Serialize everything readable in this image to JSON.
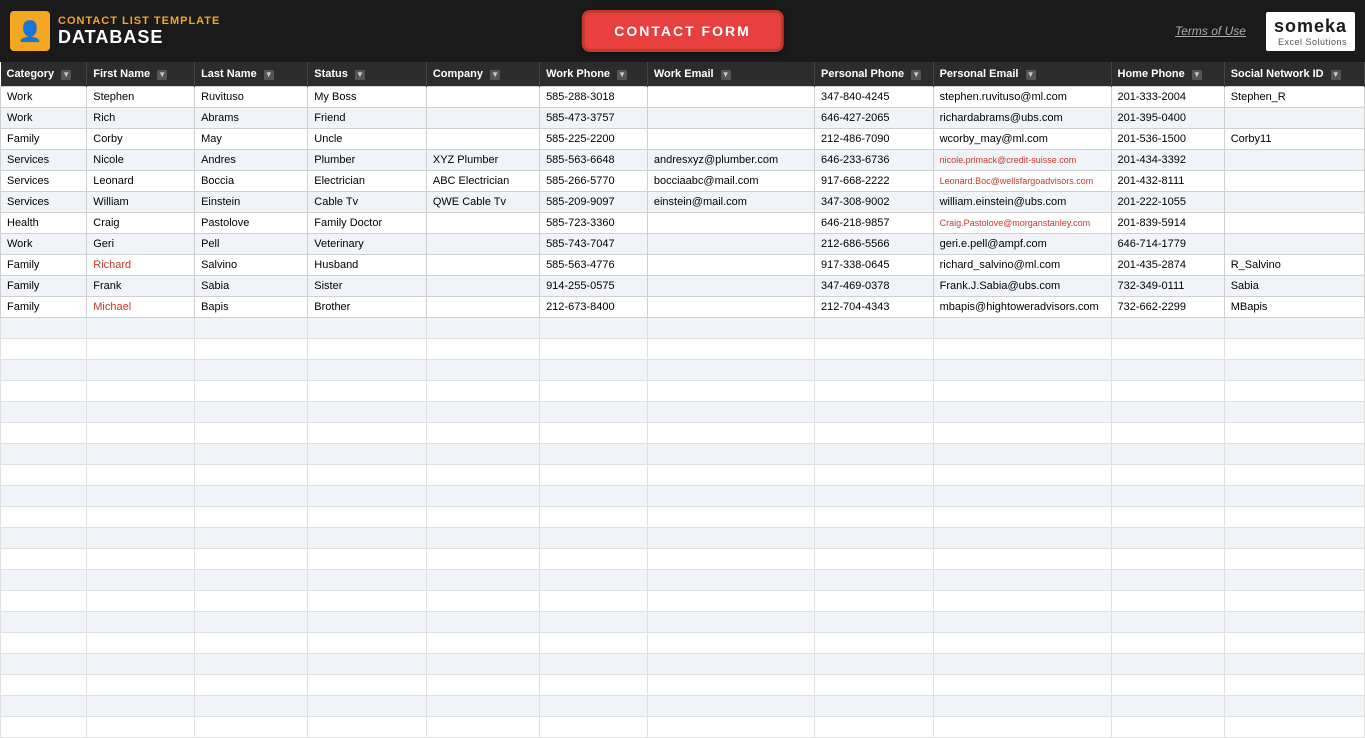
{
  "header": {
    "icon": "👤",
    "subtitle": "CONTACT LIST TEMPLATE",
    "title": "DATABASE",
    "contact_form_btn": "CONTACT FORM",
    "terms_link": "Terms of Use",
    "someka_logo": "someka",
    "someka_sub": "Excel Solutions"
  },
  "table": {
    "columns": [
      {
        "label": "Category",
        "key": "category"
      },
      {
        "label": "First Name",
        "key": "first_name"
      },
      {
        "label": "Last Name",
        "key": "last_name"
      },
      {
        "label": "Status",
        "key": "status"
      },
      {
        "label": "Company",
        "key": "company"
      },
      {
        "label": "Work Phone",
        "key": "work_phone"
      },
      {
        "label": "Work Email",
        "key": "work_email"
      },
      {
        "label": "Personal Phone",
        "key": "personal_phone"
      },
      {
        "label": "Personal Email",
        "key": "personal_email"
      },
      {
        "label": "Home Phone",
        "key": "home_phone"
      },
      {
        "label": "Social Network ID",
        "key": "social_id"
      }
    ],
    "rows": [
      {
        "category": "Work",
        "first_name": "Stephen",
        "last_name": "Ruvituso",
        "status": "My Boss",
        "company": "",
        "work_phone": "585-288-3018",
        "work_email": "",
        "personal_phone": "347-840-4245",
        "personal_email": "stephen.ruvituso@ml.com",
        "home_phone": "201-333-2004",
        "social_id": "Stephen_R",
        "first_red": false
      },
      {
        "category": "Work",
        "first_name": "Rich",
        "last_name": "Abrams",
        "status": "Friend",
        "company": "",
        "work_phone": "585-473-3757",
        "work_email": "",
        "personal_phone": "646-427-2065",
        "personal_email": "richardabrams@ubs.com",
        "home_phone": "201-395-0400",
        "social_id": "",
        "first_red": false
      },
      {
        "category": "Family",
        "first_name": "Corby",
        "last_name": "May",
        "status": "Uncle",
        "company": "",
        "work_phone": "585-225-2200",
        "work_email": "",
        "personal_phone": "212-486-7090",
        "personal_email": "wcorby_may@ml.com",
        "home_phone": "201-536-1500",
        "social_id": "Corby11",
        "first_red": false
      },
      {
        "category": "Services",
        "first_name": "Nicole",
        "last_name": "Andres",
        "status": "Plumber",
        "company": "XYZ Plumber",
        "work_phone": "585-563-6648",
        "work_email": "andresxyz@plumber.com",
        "personal_phone": "646-233-6736",
        "personal_email": "nicole.primack@credit-suisse.com",
        "home_phone": "201-434-3392",
        "social_id": "",
        "first_red": false,
        "email_small": true
      },
      {
        "category": "Services",
        "first_name": "Leonard",
        "last_name": "Boccia",
        "status": "Electrician",
        "company": "ABC Electrician",
        "work_phone": "585-266-5770",
        "work_email": "bocciaabc@mail.com",
        "personal_phone": "917-668-2222",
        "personal_email": "Leonard.Boc@wellsfargoadvisors.com",
        "home_phone": "201-432-8111",
        "social_id": "",
        "first_red": false,
        "email_small": true
      },
      {
        "category": "Services",
        "first_name": "William",
        "last_name": "Einstein",
        "status": "Cable Tv",
        "company": "QWE Cable Tv",
        "work_phone": "585-209-9097",
        "work_email": "einstein@mail.com",
        "personal_phone": "347-308-9002",
        "personal_email": "william.einstein@ubs.com",
        "home_phone": "201-222-1055",
        "social_id": "",
        "first_red": false
      },
      {
        "category": "Health",
        "first_name": "Craig",
        "last_name": "Pastolove",
        "status": "Family Doctor",
        "company": "",
        "work_phone": "585-723-3360",
        "work_email": "",
        "personal_phone": "646-218-9857",
        "personal_email": "Craig.Pastolove@morganstanley.com",
        "home_phone": "201-839-5914",
        "social_id": "",
        "first_red": false,
        "email_small": true
      },
      {
        "category": "Work",
        "first_name": "Geri",
        "last_name": "Pell",
        "status": "Veterinary",
        "company": "",
        "work_phone": "585-743-7047",
        "work_email": "",
        "personal_phone": "212-686-5566",
        "personal_email": "geri.e.pell@ampf.com",
        "home_phone": "646-714-1779",
        "social_id": "",
        "first_red": false
      },
      {
        "category": "Family",
        "first_name": "Richard",
        "last_name": "Salvino",
        "status": "Husband",
        "company": "",
        "work_phone": "585-563-4776",
        "work_email": "",
        "personal_phone": "917-338-0645",
        "personal_email": "richard_salvino@ml.com",
        "home_phone": "201-435-2874",
        "social_id": "R_Salvino",
        "first_red": true
      },
      {
        "category": "Family",
        "first_name": "Frank",
        "last_name": "Sabia",
        "status": "Sister",
        "company": "",
        "work_phone": "914-255-0575",
        "work_email": "",
        "personal_phone": "347-469-0378",
        "personal_email": "Frank.J.Sabia@ubs.com",
        "home_phone": "732-349-0111",
        "social_id": "Sabia",
        "first_red": false
      },
      {
        "category": "Family",
        "first_name": "Michael",
        "last_name": "Bapis",
        "status": "Brother",
        "company": "",
        "work_phone": "212-673-8400",
        "work_email": "",
        "personal_phone": "212-704-4343",
        "personal_email": "mbapis@hightoweradvisors.com",
        "home_phone": "732-662-2299",
        "social_id": "MBapis",
        "first_red": true
      }
    ],
    "empty_row_count": 20
  }
}
